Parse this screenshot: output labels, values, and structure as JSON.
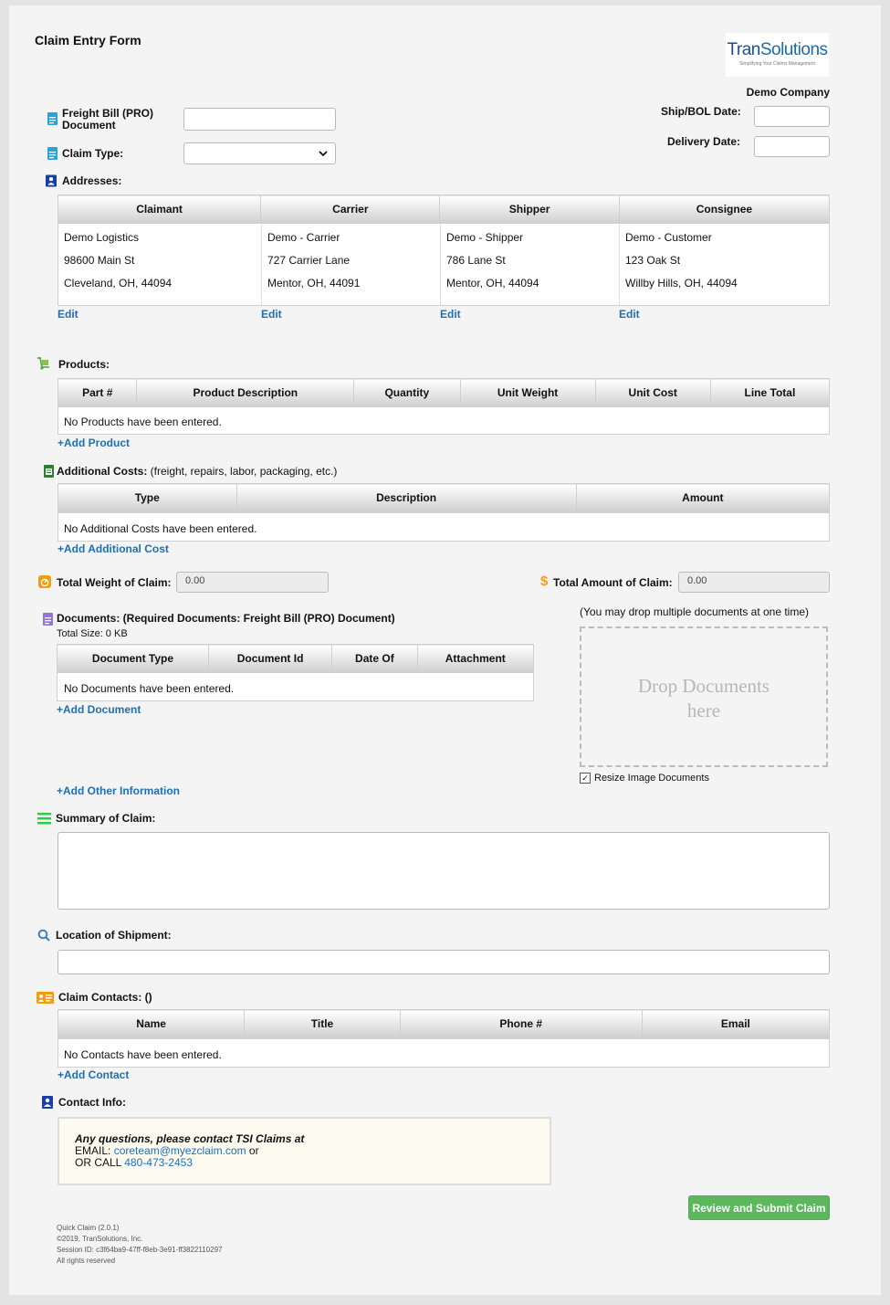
{
  "form": {
    "title": "Claim Entry Form",
    "logo_main": "Tran",
    "logo_second": "Solutions",
    "logo_tagline": "Simplifying Your Claims Management",
    "company": "Demo Company"
  },
  "fields": {
    "freight_bill_label_1": "Freight Bill (PRO)",
    "freight_bill_label_2": "Document",
    "freight_bill_value": "",
    "claim_type_label": "Claim Type:",
    "claim_type_value": "",
    "ship_bol_label": "Ship/BOL Date:",
    "ship_bol_value": "",
    "delivery_label": "Delivery Date:",
    "delivery_value": ""
  },
  "addresses": {
    "label": "Addresses:",
    "headers": [
      "Claimant",
      "Carrier",
      "Shipper",
      "Consignee"
    ],
    "columns": [
      [
        "Demo Logistics",
        "98600 Main St",
        "Cleveland, OH, 44094"
      ],
      [
        "Demo - Carrier",
        "727 Carrier Lane",
        "Mentor, OH, 44091"
      ],
      [
        "Demo - Shipper",
        "786 Lane St",
        "Mentor, OH, 44094"
      ],
      [
        "Demo - Customer",
        "123 Oak St",
        "Willby Hills, OH, 44094"
      ]
    ],
    "edit_label": "Edit"
  },
  "products": {
    "label": "Products:",
    "headers": [
      "Part #",
      "Product Description",
      "Quantity",
      "Unit Weight",
      "Unit Cost",
      "Line Total"
    ],
    "empty": "No Products have been entered.",
    "add": "+Add Product"
  },
  "costs": {
    "label": "Additional Costs:",
    "note": " (freight, repairs, labor, packaging, etc.)",
    "headers": [
      "Type",
      "Description",
      "Amount"
    ],
    "empty": "No Additional Costs have been entered.",
    "add": "+Add Additional Cost"
  },
  "totals": {
    "weight_label": "Total Weight of Claim:",
    "weight_value": "0.00",
    "amount_label": "Total Amount of Claim:",
    "amount_value": "0.00"
  },
  "documents": {
    "label": "Documents: (Required Documents: Freight Bill (PRO) Document)",
    "total_size": "Total Size: 0 KB",
    "headers": [
      "Document Type",
      "Document Id",
      "Date Of",
      "Attachment"
    ],
    "empty": "No Documents have been entered.",
    "add": "+Add Document",
    "drop_hint": "(You may drop multiple documents at one time)",
    "drop_line1": "Drop Documents",
    "drop_line2": "here",
    "resize_label": "Resize Image Documents",
    "add_other": "+Add Other Information"
  },
  "summary": {
    "label": "Summary of Claim:",
    "value": ""
  },
  "location": {
    "label": "Location of Shipment:",
    "value": ""
  },
  "contacts": {
    "label": "Claim Contacts: ()",
    "headers": [
      "Name",
      "Title",
      "Phone #",
      "Email"
    ],
    "empty": "No Contacts have been entered.",
    "add": "+Add Contact"
  },
  "contact_info": {
    "label": "Contact Info:",
    "line1": "Any questions, please contact TSI Claims at",
    "email_prefix": "EMAIL: ",
    "email": "coreteam@myezclaim.com",
    "email_suffix": " or",
    "call_prefix": "OR CALL ",
    "phone": "480-473-2453"
  },
  "submit_label": "Review and Submit Claim",
  "footer": {
    "line1": "Quick Claim (2.0.1)",
    "line2": "©2019, TranSolutions, Inc.",
    "line3": "Session ID: c3f64ba9-47ff-f8eb-3e91-ff3822110297",
    "line4": "All rights reserved"
  },
  "colors": {
    "link": "#1f6fb5",
    "submit": "#5cb85c",
    "drop_text": "#b7b7b7"
  },
  "icons": [
    "document-icon",
    "address-book-icon",
    "hand-truck-icon",
    "cost-sheet-icon",
    "weight-icon",
    "dollar-icon",
    "documents-icon",
    "list-icon",
    "search-icon",
    "contact-card-icon",
    "contact-info-icon",
    "chevron-down-icon",
    "checkbox-icon"
  ]
}
